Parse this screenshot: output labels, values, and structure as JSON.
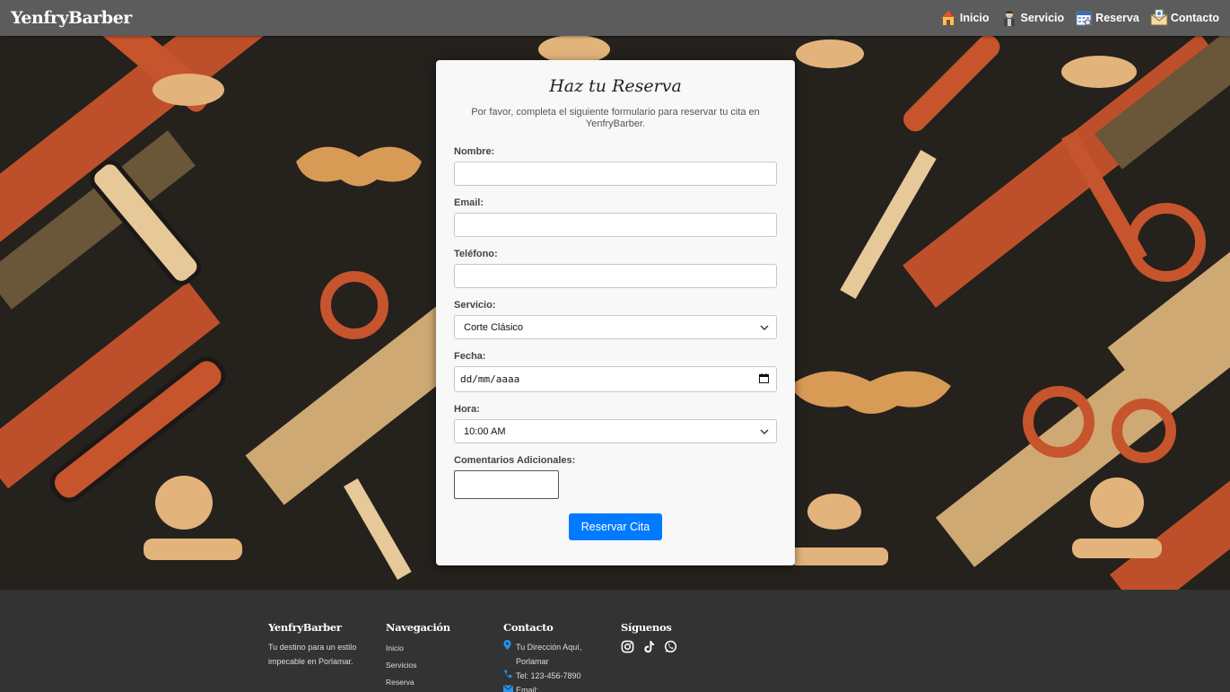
{
  "header": {
    "brand": "YenfryBarber",
    "nav": [
      {
        "label": "Inicio",
        "icon": "house-icon"
      },
      {
        "label": "Servicio",
        "icon": "barber-icon"
      },
      {
        "label": "Reserva",
        "icon": "calendar-icon"
      },
      {
        "label": "Contacto",
        "icon": "envelope-icon"
      }
    ]
  },
  "form": {
    "title": "Haz tu Reserva",
    "description": "Por favor, completa el siguiente formulario para reservar tu cita en YenfryBarber.",
    "fields": {
      "nombre": {
        "label": "Nombre:",
        "value": ""
      },
      "email": {
        "label": "Email:",
        "value": ""
      },
      "telefono": {
        "label": "Teléfono:",
        "value": ""
      },
      "servicio": {
        "label": "Servicio:",
        "value": "Corte Clásico"
      },
      "fecha": {
        "label": "Fecha:",
        "value": "dd/mm/aaaa"
      },
      "hora": {
        "label": "Hora:",
        "value": "10:00 AM"
      },
      "comentarios": {
        "label": "Comentarios Adicionales:",
        "value": ""
      }
    },
    "submit_label": "Reservar Cita",
    "submit_color": "#007bff"
  },
  "footer": {
    "about": {
      "title": "YenfryBarber",
      "text": "Tu destino para un estilo impecable en Porlamar."
    },
    "navigation": {
      "title": "Navegación",
      "links": [
        "Inicio",
        "Servicios",
        "Reserva"
      ]
    },
    "contact": {
      "title": "Contacto",
      "address": "Tu Dirección Aquí, Porlamar",
      "phone": "Tel: 123-456-7890",
      "email": "Email:"
    },
    "social": {
      "title": "Síguenos",
      "icons": [
        "instagram-icon",
        "tiktok-icon",
        "whatsapp-icon"
      ]
    }
  }
}
